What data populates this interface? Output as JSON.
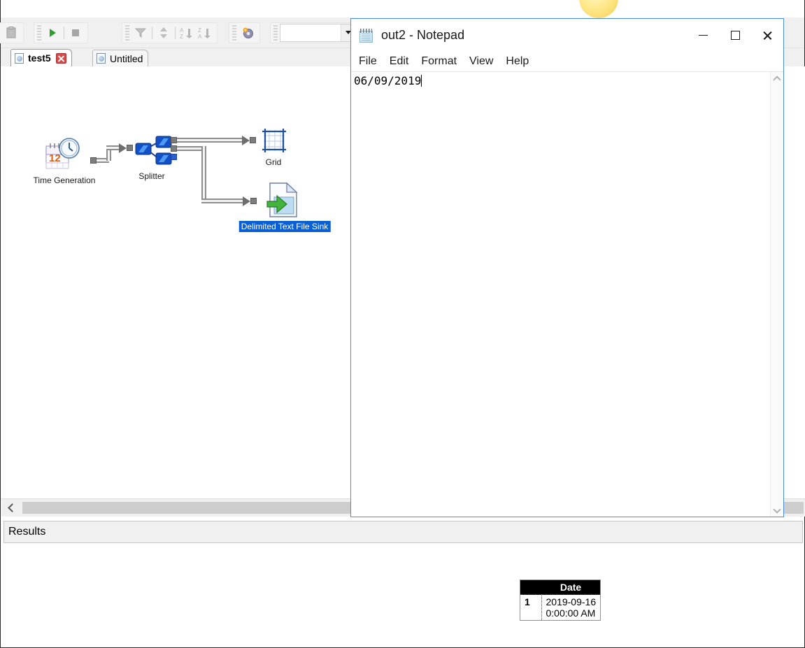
{
  "host_app": {
    "toolbar": {
      "groups": [
        {
          "buttons": [
            {
              "name": "clipboard-icon",
              "glyph": "clipboard",
              "enabled": false
            }
          ]
        },
        {
          "buttons": [
            {
              "name": "run-icon",
              "glyph": "play",
              "enabled": true
            },
            {
              "name": "stop-icon",
              "glyph": "stop",
              "enabled": false
            }
          ]
        },
        {
          "buttons": [
            {
              "name": "filter-icon",
              "glyph": "funnel",
              "enabled": false
            },
            {
              "name": "move-updown-icon",
              "glyph": "updown",
              "enabled": false
            },
            {
              "name": "sort-az-icon",
              "glyph": "az",
              "enabled": false
            },
            {
              "name": "sort-za-icon",
              "glyph": "za",
              "enabled": false
            }
          ]
        },
        {
          "buttons": [
            {
              "name": "settings-icon",
              "glyph": "gear",
              "enabled": true
            }
          ]
        }
      ],
      "combo_one_value": "",
      "combo_two_value": ""
    },
    "tabs": [
      {
        "label": "test5",
        "active": true,
        "closable": true
      },
      {
        "label": "Untitled",
        "active": false,
        "closable": false
      }
    ],
    "diagram": {
      "nodes": [
        {
          "id": "time-generation",
          "label": "Time Generation",
          "selected": false
        },
        {
          "id": "splitter",
          "label": "Splitter",
          "selected": false
        },
        {
          "id": "grid",
          "label": "Grid",
          "selected": false
        },
        {
          "id": "delimited-text-file-sink",
          "label": "Delimited Text File Sink",
          "selected": true
        }
      ]
    },
    "results_panel": {
      "title": "Results"
    },
    "result_grid": {
      "columns": [
        "",
        "Date"
      ],
      "rows": [
        {
          "index": "1",
          "date_line1": "2019-09-16",
          "date_line2": "0:00:00 AM"
        }
      ]
    }
  },
  "notepad": {
    "title": "out2 - Notepad",
    "icon": "notepad-icon",
    "window_buttons": {
      "minimize": "minimize-icon",
      "maximize": "maximize-icon",
      "close": "close-icon"
    },
    "menus": [
      "File",
      "Edit",
      "Format",
      "View",
      "Help"
    ],
    "text": "06/09/2019",
    "scrollbar": {
      "up": "scroll-up-icon",
      "down": "scroll-down-icon"
    }
  },
  "colors": {
    "accent_blue": "#4a8fd4",
    "selection_blue": "#0a5fd4",
    "toolbar_gray": "#f0f0f0",
    "grid_header_black": "#000000",
    "run_green": "#2f9e2f"
  }
}
